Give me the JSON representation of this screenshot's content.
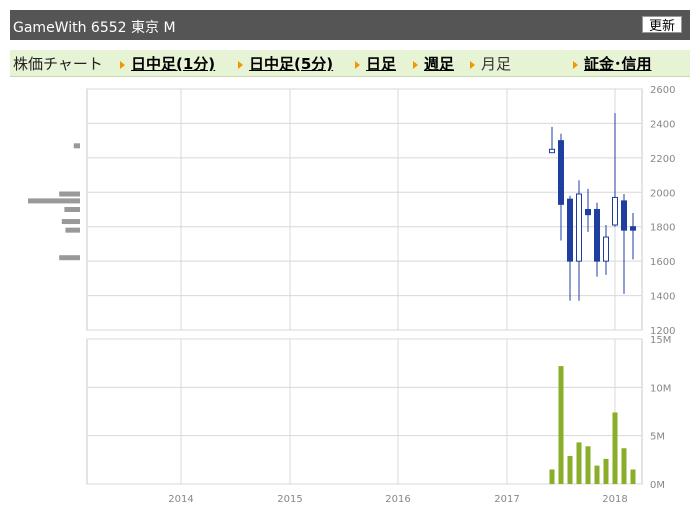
{
  "header": {
    "title": "GameWith  6552  東京 M",
    "refresh_label": "更新"
  },
  "tabs": {
    "chart_label": "株価チャート",
    "items": [
      {
        "label": "日中足(1分)",
        "link": true
      },
      {
        "label": "日中足(5分)",
        "link": true
      },
      {
        "label": "日足",
        "link": true
      },
      {
        "label": "週足",
        "link": true
      },
      {
        "label": "月足",
        "link": false
      },
      {
        "label": "証金･信用",
        "link": true
      }
    ]
  },
  "chart_data": [
    {
      "type": "candlestick",
      "title": "",
      "ylim": [
        1200,
        2600
      ],
      "yticks": [
        "2600",
        "2400",
        "2200",
        "2000",
        "1800",
        "1600",
        "1400",
        "1200"
      ],
      "colors": {
        "down": "#1f3f9f",
        "up": "#ffffff",
        "grid": "#d8d8d8"
      },
      "candles": [
        {
          "date": "2017-06",
          "open": 2230,
          "high": 2380,
          "low": 2230,
          "close": 2250
        },
        {
          "date": "2017-07",
          "open": 2300,
          "high": 2340,
          "low": 1720,
          "close": 1930
        },
        {
          "date": "2017-08",
          "open": 1960,
          "high": 1980,
          "low": 1370,
          "close": 1600
        },
        {
          "date": "2017-09",
          "open": 1600,
          "high": 2070,
          "low": 1370,
          "close": 1990
        },
        {
          "date": "2017-10",
          "open": 1900,
          "high": 2020,
          "low": 1770,
          "close": 1870
        },
        {
          "date": "2017-11",
          "open": 1900,
          "high": 1940,
          "low": 1510,
          "close": 1600
        },
        {
          "date": "2017-12",
          "open": 1600,
          "high": 1810,
          "low": 1520,
          "close": 1740
        },
        {
          "date": "2018-01",
          "open": 1810,
          "high": 2460,
          "low": 1800,
          "close": 1970
        },
        {
          "date": "2018-02",
          "open": 1950,
          "high": 1990,
          "low": 1410,
          "close": 1780
        },
        {
          "date": "2018-03",
          "open": 1800,
          "high": 1880,
          "low": 1610,
          "close": 1780
        }
      ],
      "volume_profile": [
        {
          "price": 2270,
          "volume": 0.12
        },
        {
          "price": 1990,
          "volume": 0.4
        },
        {
          "price": 1950,
          "volume": 1.0
        },
        {
          "price": 1900,
          "volume": 0.3
        },
        {
          "price": 1830,
          "volume": 0.35
        },
        {
          "price": 1780,
          "volume": 0.28
        },
        {
          "price": 1620,
          "volume": 0.4
        }
      ]
    },
    {
      "type": "bar",
      "title": "",
      "ylim": [
        0,
        15
      ],
      "yticks": [
        "15M",
        "10M",
        "5M",
        "0M"
      ],
      "color": "#8aad2a",
      "x": [
        "2017-06",
        "2017-07",
        "2017-08",
        "2017-09",
        "2017-10",
        "2017-11",
        "2017-12",
        "2018-01",
        "2018-02",
        "2018-03"
      ],
      "values": [
        1.5,
        12.2,
        2.9,
        4.3,
        3.9,
        1.9,
        2.6,
        7.4,
        3.7,
        1.5
      ]
    }
  ],
  "xaxis": {
    "ticks": [
      "2014",
      "2015",
      "2016",
      "2017",
      "2018"
    ]
  }
}
